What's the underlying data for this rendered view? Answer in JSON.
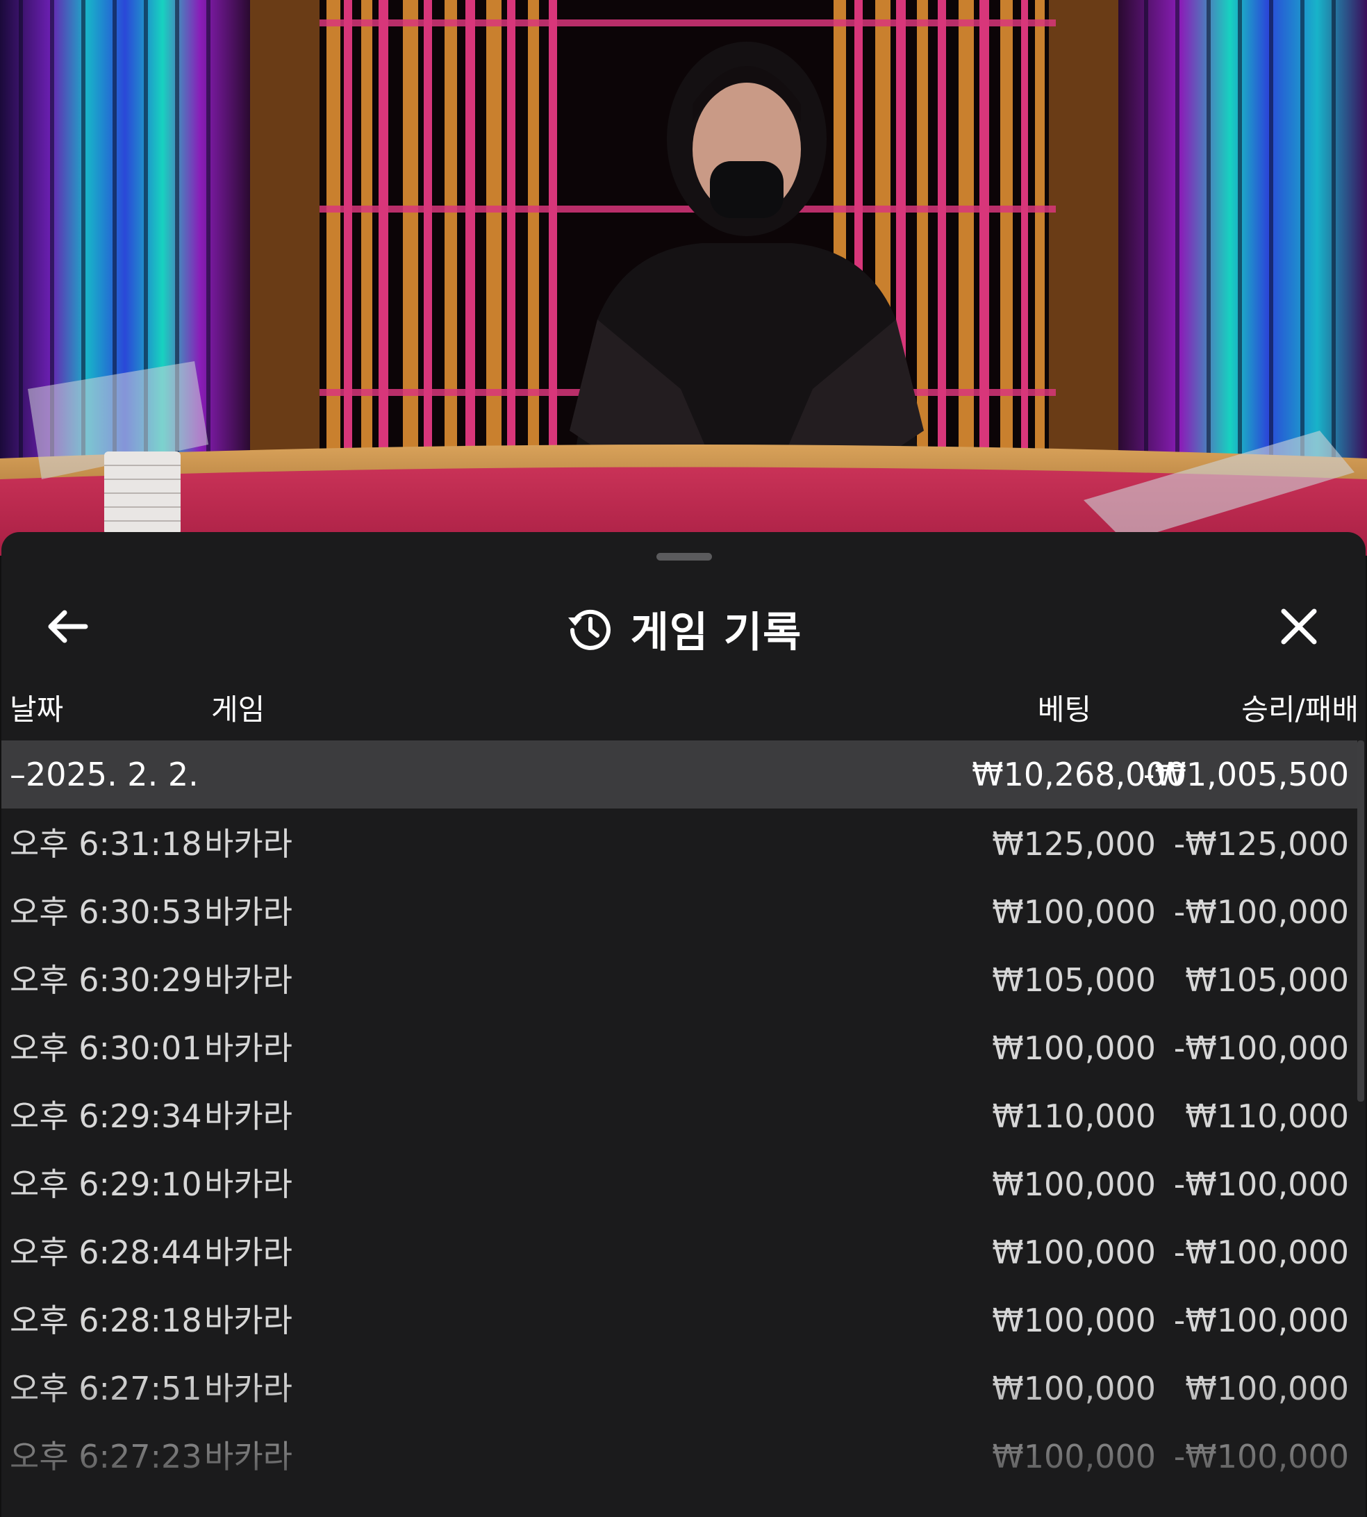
{
  "header": {
    "title": "게임 기록",
    "back_icon": "arrow-left-icon",
    "history_icon": "history-icon",
    "close_icon": "close-icon"
  },
  "columns": {
    "date": "날짜",
    "game": "게임",
    "bet": "베팅",
    "win_loss": "승리/패배"
  },
  "group": {
    "date": "–2025. 2. 2.",
    "bet_total": "₩10,268,000",
    "win_loss_total": "-₩1,005,500"
  },
  "rows": [
    {
      "time": "오후 6:31:18",
      "game": "바카라",
      "bet": "₩125,000",
      "win_loss": "-₩125,000"
    },
    {
      "time": "오후 6:30:53",
      "game": "바카라",
      "bet": "₩100,000",
      "win_loss": "-₩100,000"
    },
    {
      "time": "오후 6:30:29",
      "game": "바카라",
      "bet": "₩105,000",
      "win_loss": "₩105,000"
    },
    {
      "time": "오후 6:30:01",
      "game": "바카라",
      "bet": "₩100,000",
      "win_loss": "-₩100,000"
    },
    {
      "time": "오후 6:29:34",
      "game": "바카라",
      "bet": "₩110,000",
      "win_loss": "₩110,000"
    },
    {
      "time": "오후 6:29:10",
      "game": "바카라",
      "bet": "₩100,000",
      "win_loss": "-₩100,000"
    },
    {
      "time": "오후 6:28:44",
      "game": "바카라",
      "bet": "₩100,000",
      "win_loss": "-₩100,000"
    },
    {
      "time": "오후 6:28:18",
      "game": "바카라",
      "bet": "₩100,000",
      "win_loss": "-₩100,000"
    },
    {
      "time": "오후 6:27:51",
      "game": "바카라",
      "bet": "₩100,000",
      "win_loss": "₩100,000"
    },
    {
      "time": "오후 6:27:23",
      "game": "바카라",
      "bet": "₩100,000",
      "win_loss": "-₩100,000"
    }
  ],
  "colors": {
    "sheet_bg": "#1b1b1c",
    "group_row_bg": "#3c3c3e",
    "table_felt": "#b8244a",
    "text_primary": "#ffffff",
    "text_secondary": "#d7d7d7"
  }
}
